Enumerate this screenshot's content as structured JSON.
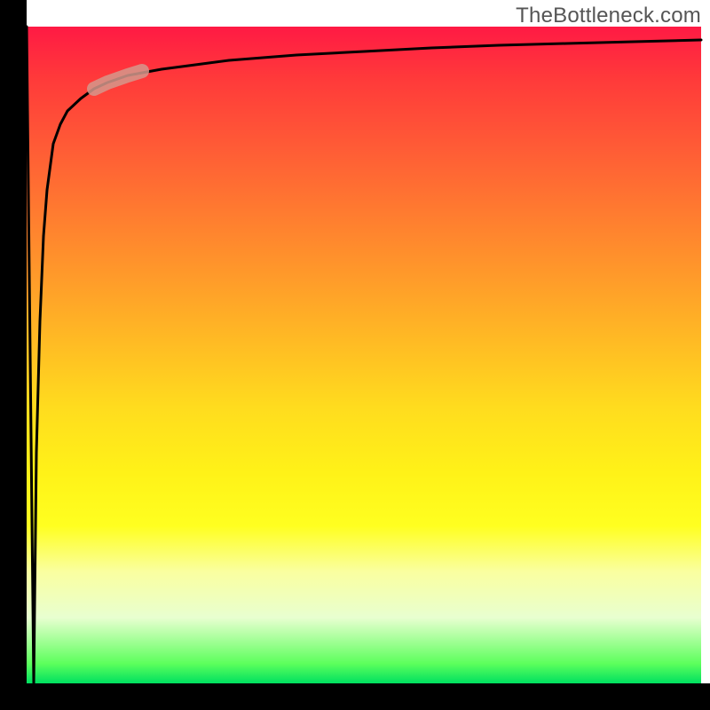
{
  "watermark": "TheBottleneck.com",
  "chart_data": {
    "type": "line",
    "title": "",
    "xlabel": "",
    "ylabel": "",
    "xlim": [
      0,
      100
    ],
    "ylim": [
      0,
      100
    ],
    "gradient_stops": [
      {
        "pos": 0.0,
        "color": "#ff1a44"
      },
      {
        "pos": 0.08,
        "color": "#ff3a3a"
      },
      {
        "pos": 0.18,
        "color": "#ff5a36"
      },
      {
        "pos": 0.28,
        "color": "#ff7a30"
      },
      {
        "pos": 0.38,
        "color": "#ff9a2a"
      },
      {
        "pos": 0.48,
        "color": "#ffbb24"
      },
      {
        "pos": 0.58,
        "color": "#ffdc1e"
      },
      {
        "pos": 0.68,
        "color": "#fff218"
      },
      {
        "pos": 0.76,
        "color": "#ffff20"
      },
      {
        "pos": 0.83,
        "color": "#faffa0"
      },
      {
        "pos": 0.9,
        "color": "#e8ffd0"
      },
      {
        "pos": 0.97,
        "color": "#5cff5c"
      },
      {
        "pos": 1.0,
        "color": "#00e060"
      }
    ],
    "series": [
      {
        "name": "curve",
        "x": [
          0,
          0.5,
          1.0,
          1.5,
          2,
          2.5,
          3,
          4,
          5,
          6,
          8,
          10,
          12,
          15,
          20,
          25,
          30,
          40,
          50,
          60,
          70,
          80,
          90,
          100
        ],
        "y": [
          100,
          50,
          0,
          35,
          55,
          68,
          75,
          82,
          85,
          87,
          89,
          90.5,
          91.5,
          92.5,
          93.5,
          94.2,
          94.8,
          95.6,
          96.2,
          96.7,
          97.1,
          97.4,
          97.7,
          98
        ]
      }
    ],
    "highlight": {
      "x_range": [
        10,
        17
      ],
      "y_range": [
        90.5,
        93
      ],
      "color": "#d5988c"
    },
    "axes": {
      "x_bar_height_fraction": 0.0375,
      "y_bar_width_fraction": 0.0375,
      "color": "#000000"
    }
  }
}
